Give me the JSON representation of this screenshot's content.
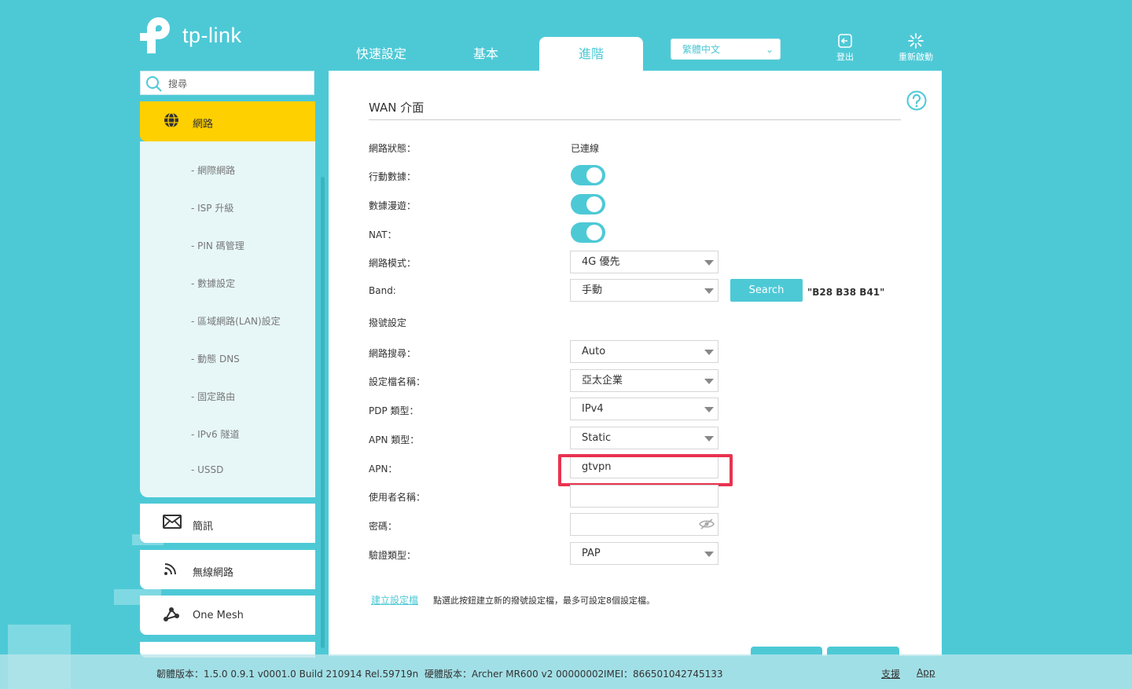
{
  "brand": {
    "name": "tp-link"
  },
  "header": {
    "tabs": [
      {
        "label": "快速設定",
        "active": false
      },
      {
        "label": "基本",
        "active": false
      },
      {
        "label": "進階",
        "active": true
      }
    ],
    "language": "繁體中文",
    "logout_label": "登出",
    "reboot_label": "重新啟動"
  },
  "sidebar": {
    "search_placeholder": "搜尋",
    "network_label": "網路",
    "sub_items": [
      "- 網際網路",
      "- ISP 升級",
      "- PIN 碼管理",
      "- 數據設定",
      "- 區域網路(LAN)設定",
      "- 動態 DNS",
      "- 固定路由",
      "- IPv6 隧道",
      "- USSD"
    ],
    "sms_label": "簡訊",
    "wireless_label": "無線網路",
    "onemesh_label": "One Mesh"
  },
  "main": {
    "section_title": "WAN 介面",
    "fields": {
      "network_status": {
        "label": "網路狀態：",
        "value": "已連線"
      },
      "mobile_data": {
        "label": "行動數據：",
        "on": true
      },
      "data_roaming": {
        "label": "數據漫遊：",
        "on": true
      },
      "nat": {
        "label": "NAT：",
        "on": true
      },
      "network_mode": {
        "label": "網路模式：",
        "value": "4G 優先"
      },
      "band": {
        "label": "Band:",
        "value": "手動",
        "button": "Search",
        "note": "\"B28 B38 B41\""
      },
      "dial_title": "撥號設定",
      "network_search": {
        "label": "網路搜尋：",
        "value": "Auto"
      },
      "profile_name": {
        "label": "設定檔名稱：",
        "value": "亞太企業"
      },
      "pdp_type": {
        "label": "PDP 類型：",
        "value": "IPv4"
      },
      "apn_type": {
        "label": "APN 類型：",
        "value": "Static"
      },
      "apn": {
        "label": "APN：",
        "value": "gtvpn"
      },
      "username": {
        "label": "使用者名稱：",
        "value": ""
      },
      "password": {
        "label": "密碼：",
        "value": ""
      },
      "auth_type": {
        "label": "驗證類型：",
        "value": "PAP"
      }
    },
    "create_profile_link": "建立設定檔",
    "create_profile_note": "點選此按鈕建立新的撥號設定檔，最多可設定8個設定檔。"
  },
  "footer": {
    "firmware": "韌體版本：1.5.0 0.9.1 v0001.0 Build 210914 Rel.59719n",
    "hardware": "硬體版本：Archer MR600 v2 00000002",
    "imei": "IMEI：866501042745133",
    "support": "支援",
    "app": "App"
  },
  "colors": {
    "accent": "#4dc9d6",
    "active_nav": "#ffd000",
    "highlight": "#e8334f"
  }
}
